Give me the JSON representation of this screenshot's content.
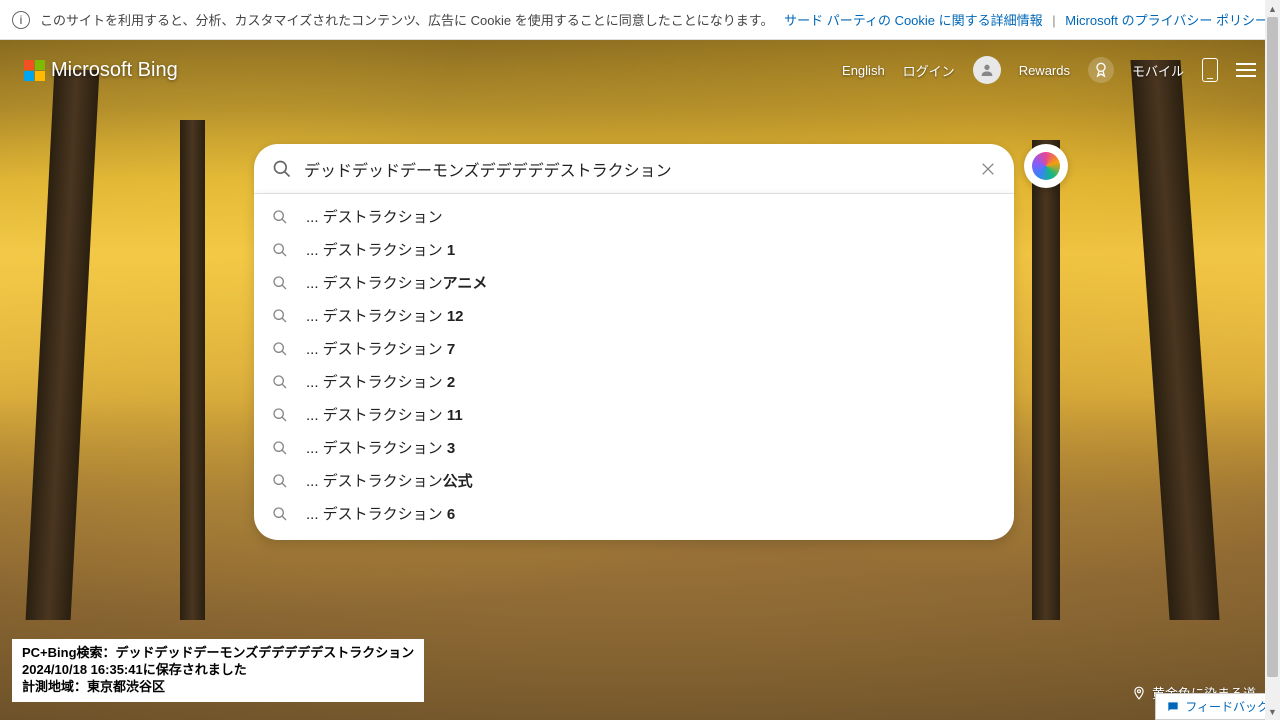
{
  "cookie_banner": {
    "text": "このサイトを利用すると、分析、カスタマイズされたコンテンツ、広告に Cookie を使用することに同意したことになります。",
    "link1": "サード パーティの Cookie に関する詳細情報",
    "link2": "Microsoft のプライバシー ポリシー"
  },
  "header": {
    "logo_text": "Microsoft Bing",
    "english": "English",
    "login": "ログイン",
    "rewards": "Rewards",
    "mobile": "モバイル"
  },
  "search": {
    "query": "デッドデッドデーモンズデデデデデストラクション",
    "suggestions": [
      {
        "prefix": "... デストラクション",
        "suffix": ""
      },
      {
        "prefix": "... デストラクション ",
        "suffix": "1"
      },
      {
        "prefix": "... デストラクション",
        "suffix": "アニメ"
      },
      {
        "prefix": "... デストラクション ",
        "suffix": "12"
      },
      {
        "prefix": "... デストラクション ",
        "suffix": "7"
      },
      {
        "prefix": "... デストラクション ",
        "suffix": "2"
      },
      {
        "prefix": "... デストラクション ",
        "suffix": "11"
      },
      {
        "prefix": "... デストラクション ",
        "suffix": "3"
      },
      {
        "prefix": "... デストラクション",
        "suffix": "公式"
      },
      {
        "prefix": "... デストラクション ",
        "suffix": "6"
      }
    ]
  },
  "info_box": {
    "line1": "PC+Bing検索：デッドデッドデーモンズデデデデデストラクション",
    "line2": "2024/10/18 16:35:41に保存されました",
    "line3": "計測地域：東京都渋谷区"
  },
  "caption": {
    "text": "黄金色に染まる道"
  },
  "feedback": {
    "label": "フィードバック"
  }
}
